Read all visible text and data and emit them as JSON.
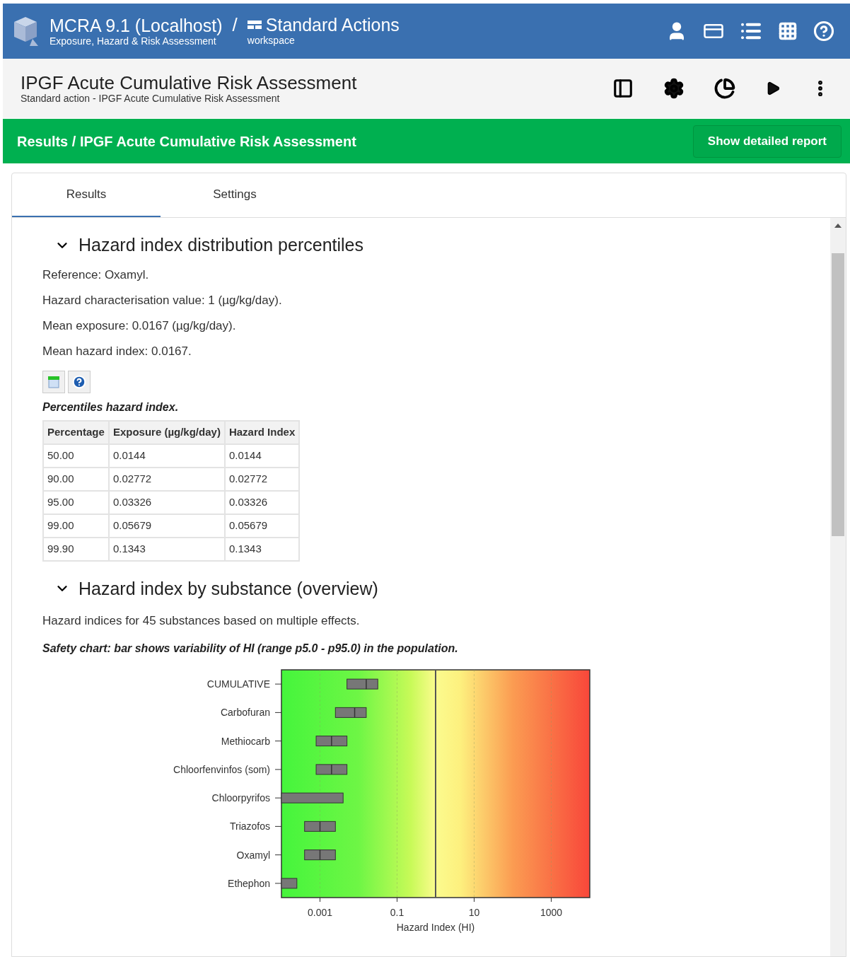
{
  "app_header": {
    "title": "MCRA 9.1 (Localhost)",
    "subtitle": "Exposure, Hazard & Risk Assessment",
    "separator": "/",
    "workspace_title": "Standard Actions",
    "workspace_subtitle": "workspace"
  },
  "action_header": {
    "title": "IPGF Acute Cumulative Risk Assessment",
    "subtitle": "Standard action - IPGF Acute Cumulative Risk Assessment"
  },
  "results_bar": {
    "title": "Results / IPGF Acute Cumulative Risk Assessment",
    "button": "Show detailed report"
  },
  "tabs": [
    {
      "label": "Results",
      "selected": true
    },
    {
      "label": "Settings",
      "selected": false
    }
  ],
  "percentiles_section": {
    "title": "Hazard index distribution percentiles",
    "expanded": true,
    "lines": [
      "Reference: Oxamyl.",
      "Hazard characterisation value: 1 (µg/kg/day).",
      "Mean exposure: 0.0167 (µg/kg/day).",
      "Mean hazard index: 0.0167."
    ],
    "caption": "Percentiles hazard index.",
    "table": {
      "columns": [
        "Percentage",
        "Exposure (µg/kg/day)",
        "Hazard Index"
      ],
      "rows": [
        [
          "50.00",
          "0.0144",
          "0.0144"
        ],
        [
          "90.00",
          "0.02772",
          "0.02772"
        ],
        [
          "95.00",
          "0.03326",
          "0.03326"
        ],
        [
          "99.00",
          "0.05679",
          "0.05679"
        ],
        [
          "99.90",
          "0.1343",
          "0.1343"
        ]
      ]
    }
  },
  "substance_section": {
    "title": "Hazard index by substance (overview)",
    "expanded": true,
    "text": "Hazard indices for 45 substances based on multiple effects.",
    "caption": "Safety chart: bar shows variability of HI (range p5.0 - p95.0) in the population.",
    "safety_chart": {
      "xlabel": "Hazard Index (HI)",
      "categories": [
        "CUMULATIVE",
        "Carbofuran",
        "Methiocarb",
        "Chloorfenvinfos (som)",
        "Chloorpyrifos",
        "Triazofos",
        "Oxamyl",
        "Ethephon"
      ],
      "tick_labels": [
        "0.001",
        "0.1",
        "10",
        "1000"
      ]
    }
  }
}
